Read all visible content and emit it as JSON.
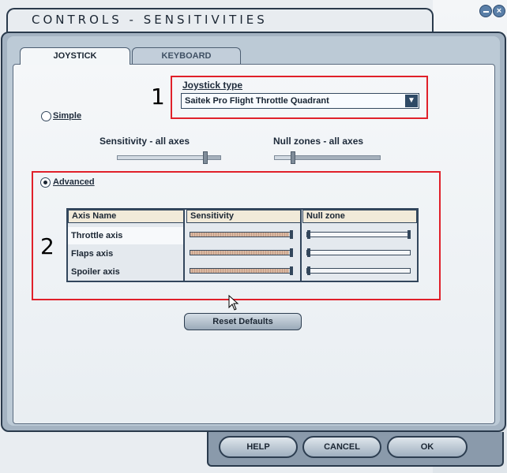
{
  "window": {
    "title": "CONTROLS - SENSITIVITIES"
  },
  "tabs": [
    {
      "label": "JOYSTICK",
      "active": true
    },
    {
      "label": "KEYBOARD",
      "active": false
    }
  ],
  "annotations": [
    "1",
    "2"
  ],
  "joystick_type": {
    "label": "Joystick type",
    "selected": "Saitek Pro Flight Throttle Quadrant"
  },
  "simple": {
    "label": "Simple",
    "selected": false,
    "sensitivity_label": "Sensitivity - all axes",
    "null_zone_label": "Null zones - all axes"
  },
  "advanced": {
    "label": "Advanced",
    "selected": true
  },
  "axes_table": {
    "headers": [
      "Axis Name",
      "Sensitivity",
      "Null zone"
    ],
    "rows": [
      {
        "name": "Throttle axis",
        "sensitivity": 0.98,
        "null_zone": 1.0,
        "selected": true
      },
      {
        "name": "Flaps axis",
        "sensitivity": 0.98,
        "null_zone": 0.0,
        "selected": false
      },
      {
        "name": "Spoiler axis",
        "sensitivity": 0.98,
        "null_zone": 0.0,
        "selected": false
      }
    ]
  },
  "buttons": {
    "reset": "Reset Defaults",
    "help": "HELP",
    "cancel": "CANCEL",
    "ok": "OK"
  },
  "colors": {
    "annotation_box": "#e0202a",
    "frame": "#2a3a4c"
  },
  "icons": {
    "dropdown": "chevron-down-icon",
    "minimize": "minimize-icon",
    "close": "close-icon",
    "cursor": "mouse-pointer-icon"
  }
}
